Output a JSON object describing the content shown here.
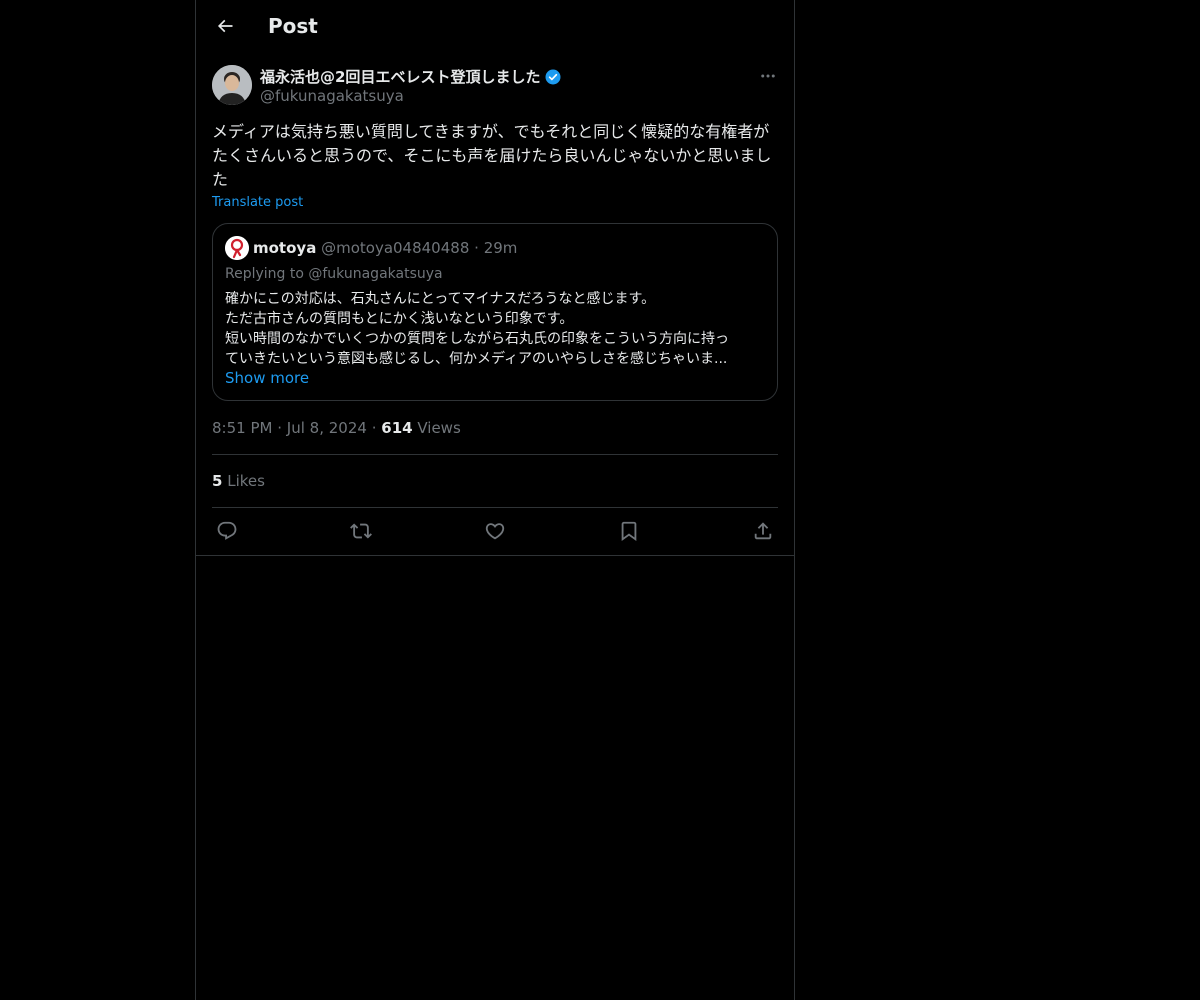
{
  "header": {
    "title": "Post"
  },
  "post": {
    "author_name": "福永活也@2回目エベレスト登頂しました",
    "author_handle": "@fukunagakatsuya",
    "text": "メディアは気持ち悪い質問してきますが、でもそれと同じく懐疑的な有権者がたくさんいると思うので、そこにも声を届けたら良いんじゃないかと思いました",
    "translate_label": "Translate post",
    "time": "8:51 PM",
    "date": "Jul 8, 2024",
    "views_count": "614",
    "views_label": "Views",
    "likes_count": "5",
    "likes_label": "Likes",
    "separator": "·"
  },
  "quote": {
    "name": "motoya",
    "handle": "@motoya04840488",
    "age": "29m",
    "replying": "Replying to @fukunagakatsuya",
    "lines": [
      "確かにこの対応は、石丸さんにとってマイナスだろうなと感じます。",
      "ただ古市さんの質問もとにかく浅いなという印象です。",
      "短い時間のなかでいくつかの質問をしながら石丸氏の印象をこういう方向に持っ",
      "ていきたいという意図も感じるし、何かメディアのいやらしさを感じちゃいま..."
    ],
    "show_more": "Show more"
  },
  "colors": {
    "background": "#000000",
    "text": "#e7e9ea",
    "muted": "#71767b",
    "accent": "#1d9bf0",
    "border": "#2f3336"
  },
  "icons": {
    "back": "arrow-left-icon",
    "verified": "verified-badge-icon",
    "more": "more-dots-icon",
    "reply": "reply-icon",
    "repost": "repost-icon",
    "like": "heart-icon",
    "bookmark": "bookmark-icon",
    "share": "share-icon"
  }
}
